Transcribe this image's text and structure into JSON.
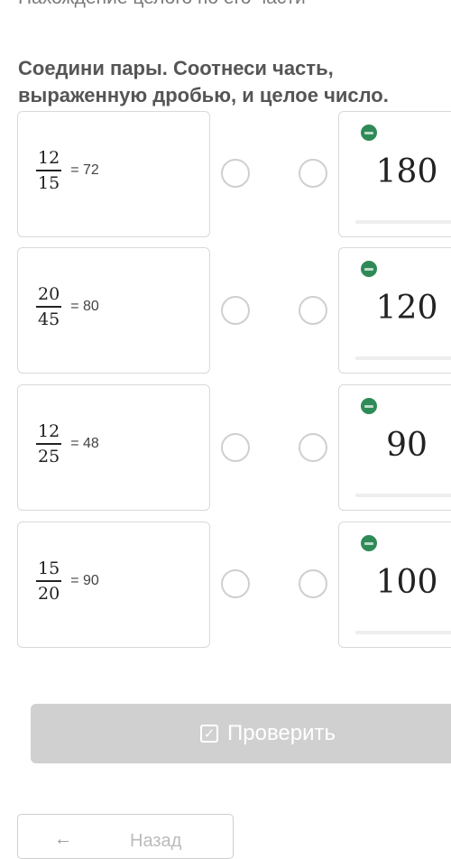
{
  "page": {
    "top_title": "Нахождение целого по его части"
  },
  "task": {
    "instruction": "Соедини пары. Соотнеси часть, выраженную дробью, и целое число."
  },
  "left_items": [
    {
      "numerator": "12",
      "denominator": "15",
      "equals": "= 72"
    },
    {
      "numerator": "20",
      "denominator": "45",
      "equals": "= 80"
    },
    {
      "numerator": "12",
      "denominator": "25",
      "equals": "= 48"
    },
    {
      "numerator": "15",
      "denominator": "20",
      "equals": "= 90"
    }
  ],
  "right_items": [
    {
      "value": "180"
    },
    {
      "value": "120"
    },
    {
      "value": "90"
    },
    {
      "value": "100"
    }
  ],
  "buttons": {
    "check_label": "Проверить",
    "check_icon": "checkbox-check-icon",
    "back_label": "Назад",
    "back_icon": "arrow-left-icon"
  },
  "colors": {
    "badge": "#2e8b57",
    "check_button_disabled": "#d0d0d0"
  }
}
